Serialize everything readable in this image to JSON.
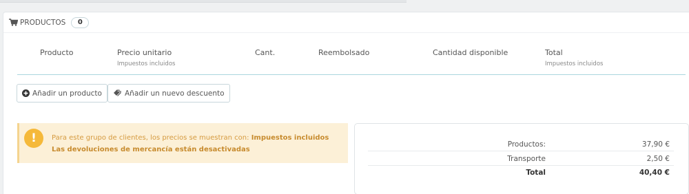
{
  "panel": {
    "title": "PRODUCTOS",
    "count": "0"
  },
  "table": {
    "columns": [
      {
        "label": "Producto",
        "sub": ""
      },
      {
        "label": "Precio unitario",
        "sub": "Impuestos incluidos"
      },
      {
        "label": "Cant.",
        "sub": ""
      },
      {
        "label": "Reembolsado",
        "sub": ""
      },
      {
        "label": "Cantidad disponible",
        "sub": ""
      },
      {
        "label": "Total",
        "sub": "Impuestos incluidos"
      }
    ]
  },
  "actions": {
    "add_product": "Añadir un producto",
    "add_discount": "Añadir un nuevo descuento"
  },
  "alert": {
    "line1_prefix": "Para este grupo de clientes, los precios se muestran con:",
    "line1_bold": "Impuestos incluidos",
    "line2": "Las devoluciones de mercancía están desactivadas"
  },
  "summary": {
    "rows": [
      {
        "label": "Productos:",
        "value": "37,90 €"
      },
      {
        "label": "Transporte",
        "value": "2,50 €"
      },
      {
        "label": "Total",
        "value": "40,40 €"
      }
    ]
  },
  "colors": {
    "accent": "#a9d5de",
    "warning_bg": "#fcf0d7",
    "warning_text": "#d59a3f",
    "warning_icon": "#f5b93a"
  }
}
